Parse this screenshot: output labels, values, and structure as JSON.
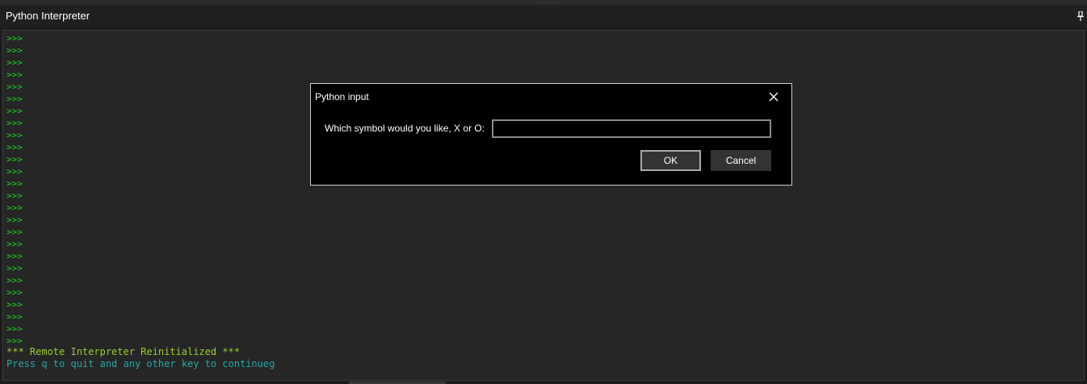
{
  "window": {
    "title": "Python Interpreter",
    "grip": "·······"
  },
  "console": {
    "prompts": [
      ">>>",
      ">>>",
      ">>>",
      ">>>",
      ">>>",
      ">>>",
      ">>>",
      ">>>",
      ">>>",
      ">>>",
      ">>>",
      ">>>",
      ">>>",
      ">>>",
      ">>>",
      ">>>",
      ">>>",
      ">>>",
      ">>>",
      ">>>",
      ">>>",
      ">>>",
      ">>>",
      ">>>",
      ">>>",
      ">>>"
    ],
    "reinit_message": "*** Remote Interpreter Reinitialized ***",
    "continue_message": "Press q to quit and any other key to continueg"
  },
  "dialog": {
    "title": "Python input",
    "prompt_label": "Which symbol would you like, X or O:",
    "input_value": "",
    "ok_label": "OK",
    "cancel_label": "Cancel"
  },
  "icons": {
    "pin": "pin-icon",
    "close": "close-icon"
  },
  "colors": {
    "prompt": "#22cc22",
    "reinit": "#9acd32",
    "continue": "#2aa5a5",
    "console_bg": "#262626",
    "dialog_bg": "#000000"
  }
}
